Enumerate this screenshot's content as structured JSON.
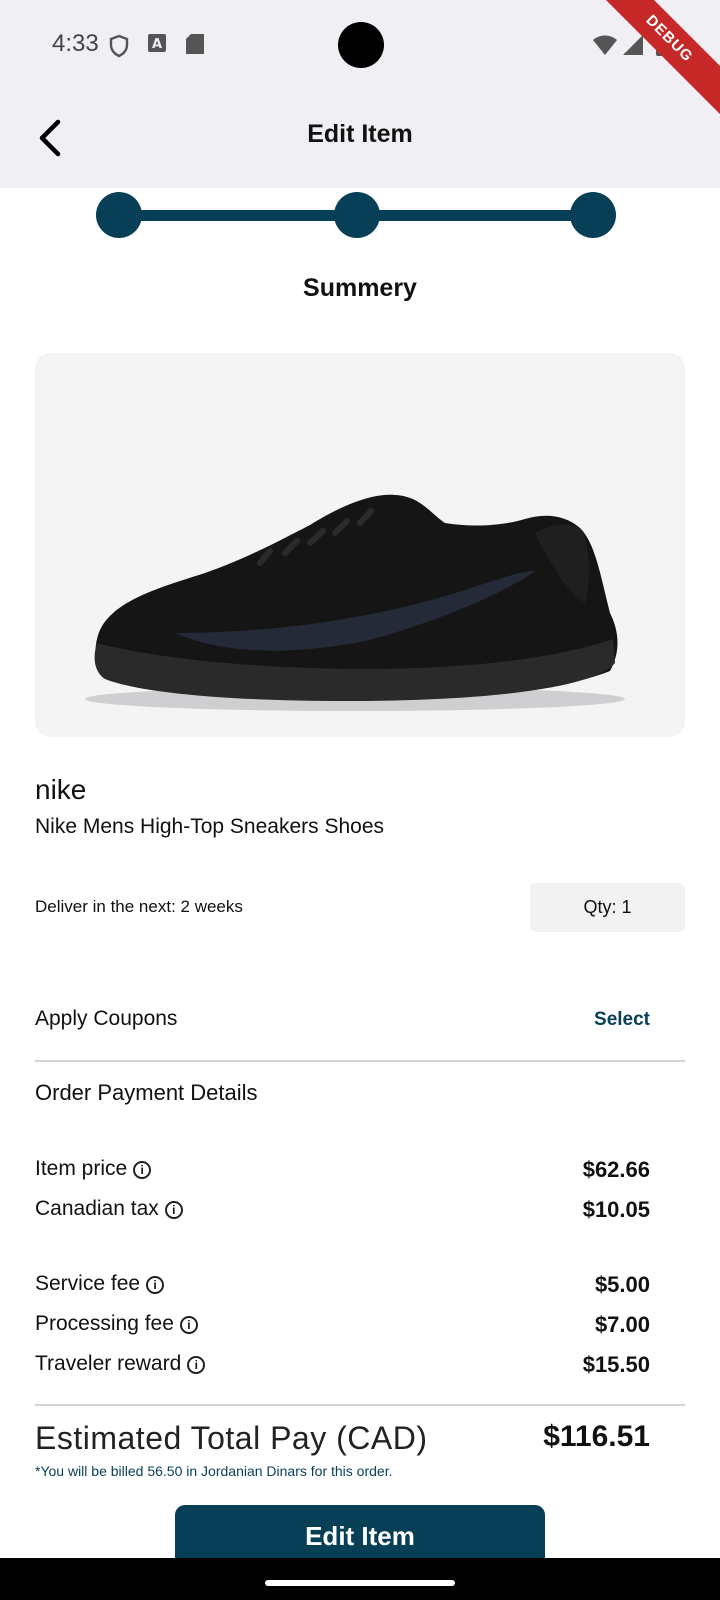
{
  "status_bar": {
    "time": "4:33",
    "debug_label": "DEBUG"
  },
  "app_bar": {
    "title": "Edit Item"
  },
  "stepper": {
    "steps": 3,
    "current": 3,
    "label": "Summery",
    "color": "#073f57"
  },
  "product": {
    "brand": "nike",
    "name": "Nike Mens High-Top Sneakers Shoes",
    "delivery": "Deliver in the next: 2 weeks",
    "qty": "Qty: 1"
  },
  "coupons": {
    "label": "Apply Coupons",
    "action": "Select"
  },
  "payment": {
    "title": "Order Payment Details",
    "rows": [
      {
        "label": "Item price",
        "value": "$62.66"
      },
      {
        "label": "Canadian tax",
        "value": "$10.05"
      },
      {
        "label": "Service fee",
        "value": "$5.00"
      },
      {
        "label": "Processing fee",
        "value": "$7.00"
      },
      {
        "label": "Traveler reward",
        "value": "$15.50"
      }
    ],
    "total_label": "Estimated Total Pay (CAD)",
    "total_value": "$116.51",
    "note": "*You will be billed 56.50 in Jordanian Dinars for this order."
  },
  "cta": {
    "label": "Edit Item"
  },
  "colors": {
    "accent": "#073f57",
    "app_bar_bg": "#efeff4"
  }
}
